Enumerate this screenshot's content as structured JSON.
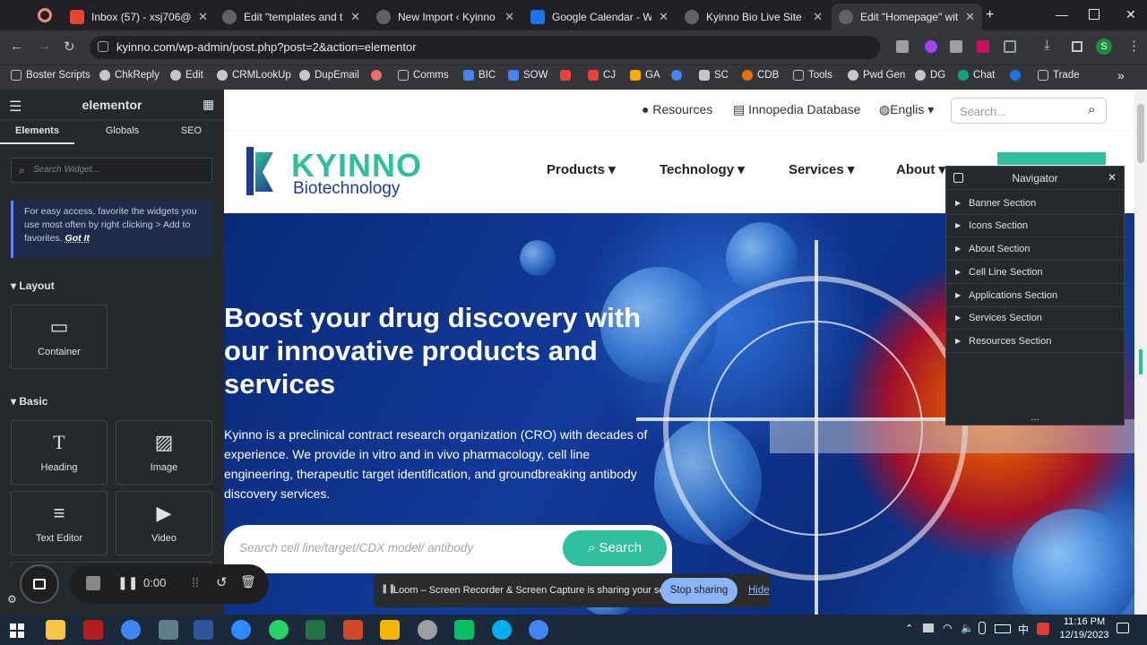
{
  "tabs": [
    {
      "title": "Inbox (57) - xsj706@gm",
      "favicon": "gmail-icon",
      "color": "#ea4335"
    },
    {
      "title": "Edit \"templates and tuto",
      "favicon": "wordpress-icon",
      "color": "#8ab4f8"
    },
    {
      "title": "New Import ‹ Kyinno Bio",
      "favicon": "wordpress-icon",
      "color": "#8ab4f8"
    },
    {
      "title": "Google Calendar - Week",
      "favicon": "calendar-icon",
      "color": "#1a73e8"
    },
    {
      "title": "Kyinno Bio Live Site - Fly",
      "favicon": "globe-icon",
      "color": "#8ab4f8"
    },
    {
      "title": "Edit \"Homepage\" with E",
      "favicon": "globe-icon",
      "color": "#8ab4f8"
    }
  ],
  "url": "kyinno.com/wp-admin/post.php?post=2&action=elementor",
  "bookmarks": [
    "Boster Scripts",
    "ChkReply",
    "Edit",
    "CRMLookUp",
    "DupEmail",
    "",
    "Comms",
    "BIC",
    "SOW",
    "",
    "CJ",
    "GA",
    "",
    "SC",
    "CDB",
    "Tools",
    "Pwd Gen",
    "DG",
    "Chat",
    "",
    "Trade"
  ],
  "profile_initial": "S",
  "panel": {
    "brand": "elementor",
    "tabs": [
      "Elements",
      "Globals",
      "SEO"
    ],
    "search_placeholder": "Search Widget...",
    "tip": "For easy access, favorite the widgets you use most often by right clicking > Add to favorites.",
    "tip_link": "Got It",
    "layout_title": "Layout",
    "basic_title": "Basic",
    "widgets": [
      "Container",
      "Heading",
      "Image",
      "Text Editor",
      "Video"
    ]
  },
  "site": {
    "top_links": [
      "Resources",
      "Innopedia Database",
      "Englis"
    ],
    "search_placeholder": "Search...",
    "logo_main": "KYINNO",
    "logo_sub": "Biotechnology",
    "menu": [
      "Products",
      "Technology",
      "Services",
      "About"
    ],
    "headline": "Boost your drug discovery with our innovative products and services",
    "intro": "Kyinno is a preclinical contract research organization (CRO) with decades of experience. We provide in vitro and in vivo pharmacology, cell line engineering, therapeutic target identification, and groundbreaking antibody discovery services.",
    "hero_search_placeholder": "Search cell line/target/CDX model/ antibody",
    "hero_search_button": "Search"
  },
  "navigator": {
    "title": "Navigator",
    "items": [
      "Banner Section",
      "Icons Section",
      "About Section",
      "Cell Line Section",
      "Applications Section",
      "Services Section",
      "Resources Section"
    ],
    "more": "..."
  },
  "recorder": {
    "time": "0:00"
  },
  "loom": {
    "text": "Loom – Screen Recorder & Screen Capture is sharing your screen.",
    "stop": "Stop sharing",
    "hide": "Hide"
  },
  "clock": {
    "time": "11:16 PM",
    "date": "12/19/2023"
  },
  "tray_lang": "中"
}
